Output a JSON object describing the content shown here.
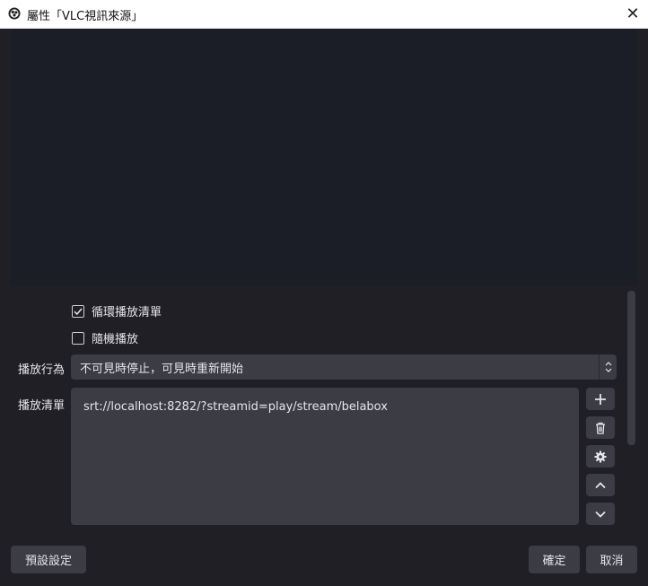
{
  "window": {
    "title": "屬性「VLC視訊來源」",
    "close_glyph": "✕"
  },
  "options": {
    "loop_label": "循環播放清單",
    "loop_checked": true,
    "shuffle_label": "隨機播放",
    "shuffle_checked": false
  },
  "playback": {
    "label": "播放行為",
    "selected": "不可見時停止，可見時重新開始"
  },
  "playlist": {
    "label": "播放清單",
    "items": [
      "srt://localhost:8282/?streamid=play/stream/belabox"
    ]
  },
  "playlist_buttons": [
    "plus-icon",
    "trash-icon",
    "gear-icon",
    "chevron-up-icon",
    "chevron-down-icon"
  ],
  "footer": {
    "defaults_label": "預設設定",
    "ok_label": "確定",
    "cancel_label": "取消"
  },
  "colors": {
    "background": "#1f1f25",
    "panel": "#3b3c44",
    "preview": "#1b1d27",
    "titlebar": "#ffffff"
  }
}
